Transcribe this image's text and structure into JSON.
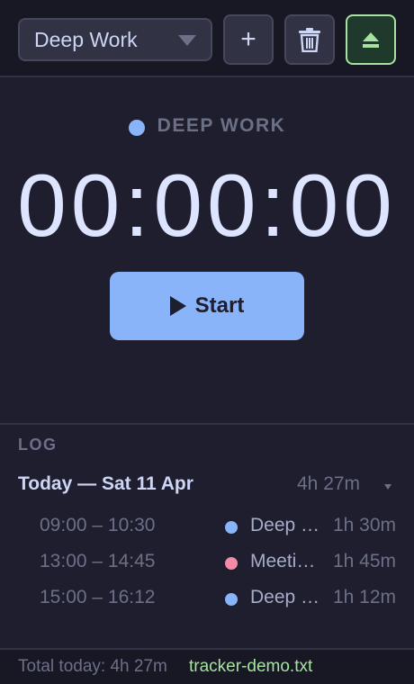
{
  "toolbar": {
    "project_select": {
      "value": "Deep Work"
    },
    "add_label": "+",
    "delete_icon": "trash-icon",
    "eject_icon": "eject-icon"
  },
  "timer": {
    "project_label": "DEEP WORK",
    "project_color": "#89b4fa",
    "display": "00:00:00",
    "start_label": "Start"
  },
  "log": {
    "title": "LOG",
    "day": {
      "label": "Today — Sat 11 Apr",
      "total": "4h 27m",
      "entries": [
        {
          "range": "09:00 – 10:30",
          "name": "Deep Work",
          "duration": "1h 30m",
          "color": "#89b4fa"
        },
        {
          "range": "13:00 – 14:45",
          "name": "Meetings",
          "duration": "1h 45m",
          "color": "#f38ba8"
        },
        {
          "range": "15:00 – 16:12",
          "name": "Deep Work",
          "duration": "1h 12m",
          "color": "#89b4fa"
        }
      ]
    }
  },
  "footer": {
    "total": "Total today: 4h 27m",
    "file": "tracker-demo.txt"
  }
}
